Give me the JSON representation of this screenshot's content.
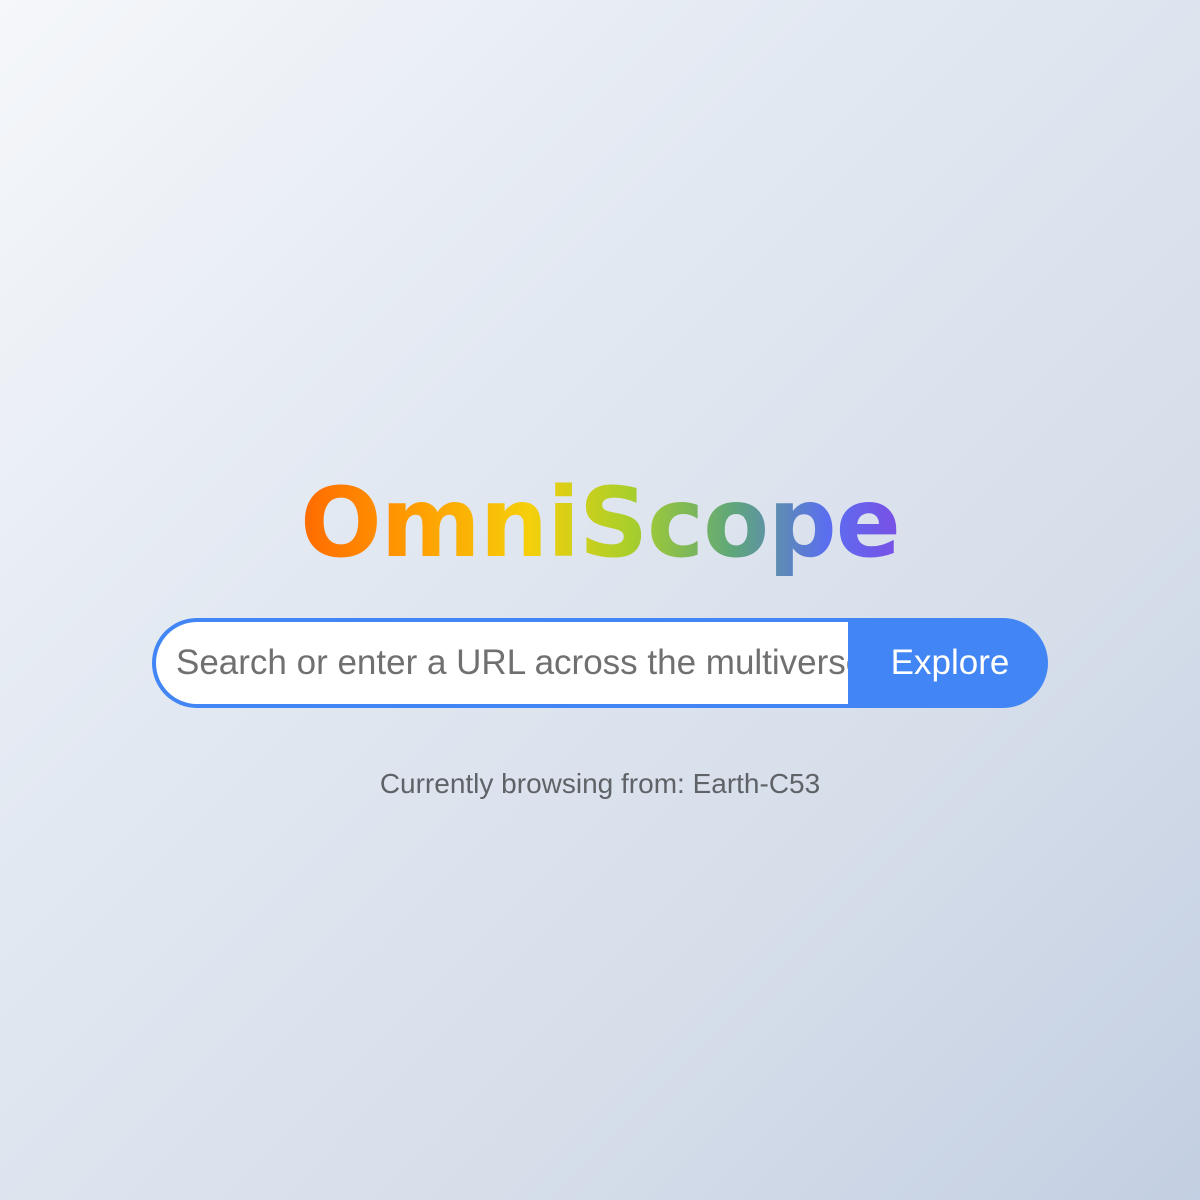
{
  "app": {
    "logo_text": "OmniScope"
  },
  "search": {
    "placeholder": "Search or enter a URL across the multiverse...",
    "value": "",
    "button_label": "Explore"
  },
  "status": {
    "text": "Currently browsing from: Earth-C53"
  },
  "colors": {
    "accent": "#4285f4",
    "logo_gradient": [
      "#ff6a00",
      "#f6cf0a",
      "#a9cf2b",
      "#5b6ef0",
      "#7a4fe6"
    ],
    "status_text": "#5f6368"
  }
}
